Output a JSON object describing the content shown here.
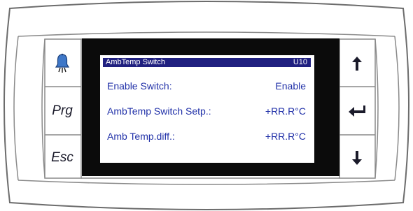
{
  "screen": {
    "header": {
      "title": "AmbTemp Switch",
      "code": "U10"
    },
    "rows": [
      {
        "label": "Enable Switch:",
        "value": "Enable"
      },
      {
        "label": "AmbTemp Switch Setp.:",
        "value": "+RR.R°C"
      },
      {
        "label": "Amb Temp.diff.:",
        "value": "+RR.R°C"
      }
    ]
  },
  "buttons": {
    "alarm": {
      "icon": "bell-icon"
    },
    "prg": {
      "label": "Prg"
    },
    "esc": {
      "label": "Esc"
    },
    "up": {
      "icon": "arrow-up-icon"
    },
    "enter": {
      "icon": "enter-icon"
    },
    "down": {
      "icon": "arrow-down-icon"
    }
  },
  "colors": {
    "header_bg": "#202080",
    "lcd_text": "#2030a8",
    "bell_blue": "#3f78c8"
  }
}
